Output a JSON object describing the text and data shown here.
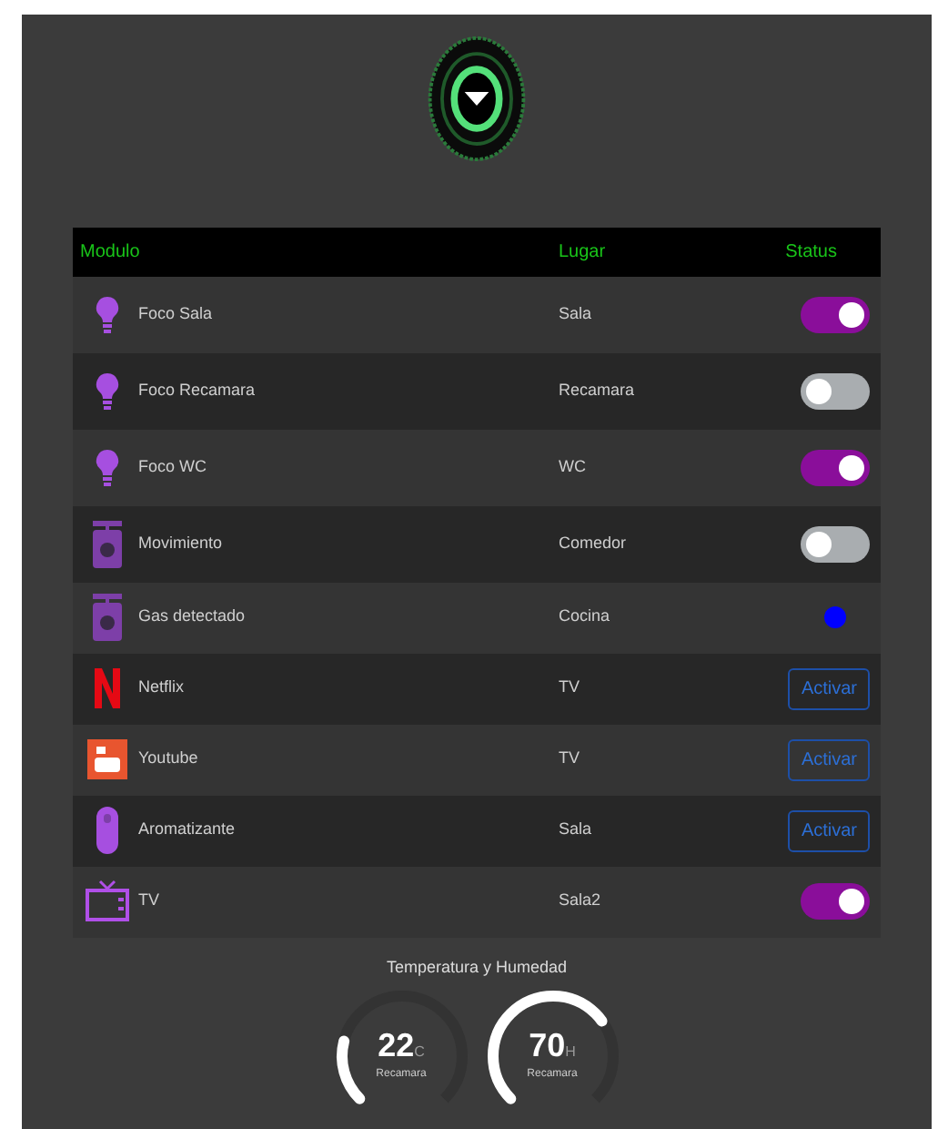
{
  "table": {
    "columns": [
      "Modulo",
      "Lugar",
      "Status"
    ],
    "rows": [
      {
        "modulo": "Foco Sala",
        "lugar": "Sala",
        "status": {
          "kind": "toggle",
          "on": true
        }
      },
      {
        "modulo": "Foco Recamara",
        "lugar": "Recamara",
        "status": {
          "kind": "toggle",
          "on": false
        }
      },
      {
        "modulo": "Foco WC",
        "lugar": "WC",
        "status": {
          "kind": "toggle",
          "on": true
        }
      },
      {
        "modulo": "Movimiento",
        "lugar": "Comedor",
        "status": {
          "kind": "toggle",
          "on": false
        }
      },
      {
        "modulo": "Gas detectado",
        "lugar": "Cocina",
        "status": {
          "kind": "indicator",
          "color": "#0000ff"
        }
      },
      {
        "modulo": "Netflix",
        "lugar": "TV",
        "status": {
          "kind": "button",
          "label": "Activar"
        }
      },
      {
        "modulo": "Youtube",
        "lugar": "TV",
        "status": {
          "kind": "button",
          "label": "Activar"
        }
      },
      {
        "modulo": "Aromatizante",
        "lugar": "Sala",
        "status": {
          "kind": "button",
          "label": "Activar"
        }
      },
      {
        "modulo": "TV",
        "lugar": "Sala2",
        "status": {
          "kind": "toggle",
          "on": true
        }
      }
    ]
  },
  "sensors": {
    "title": "Temperatura y Humedad",
    "gauges": [
      {
        "value": "22",
        "unit": "C",
        "label": "Recamara",
        "level": 0.22
      },
      {
        "value": "70",
        "unit": "H",
        "label": "Recamara",
        "level": 0.7
      }
    ]
  }
}
